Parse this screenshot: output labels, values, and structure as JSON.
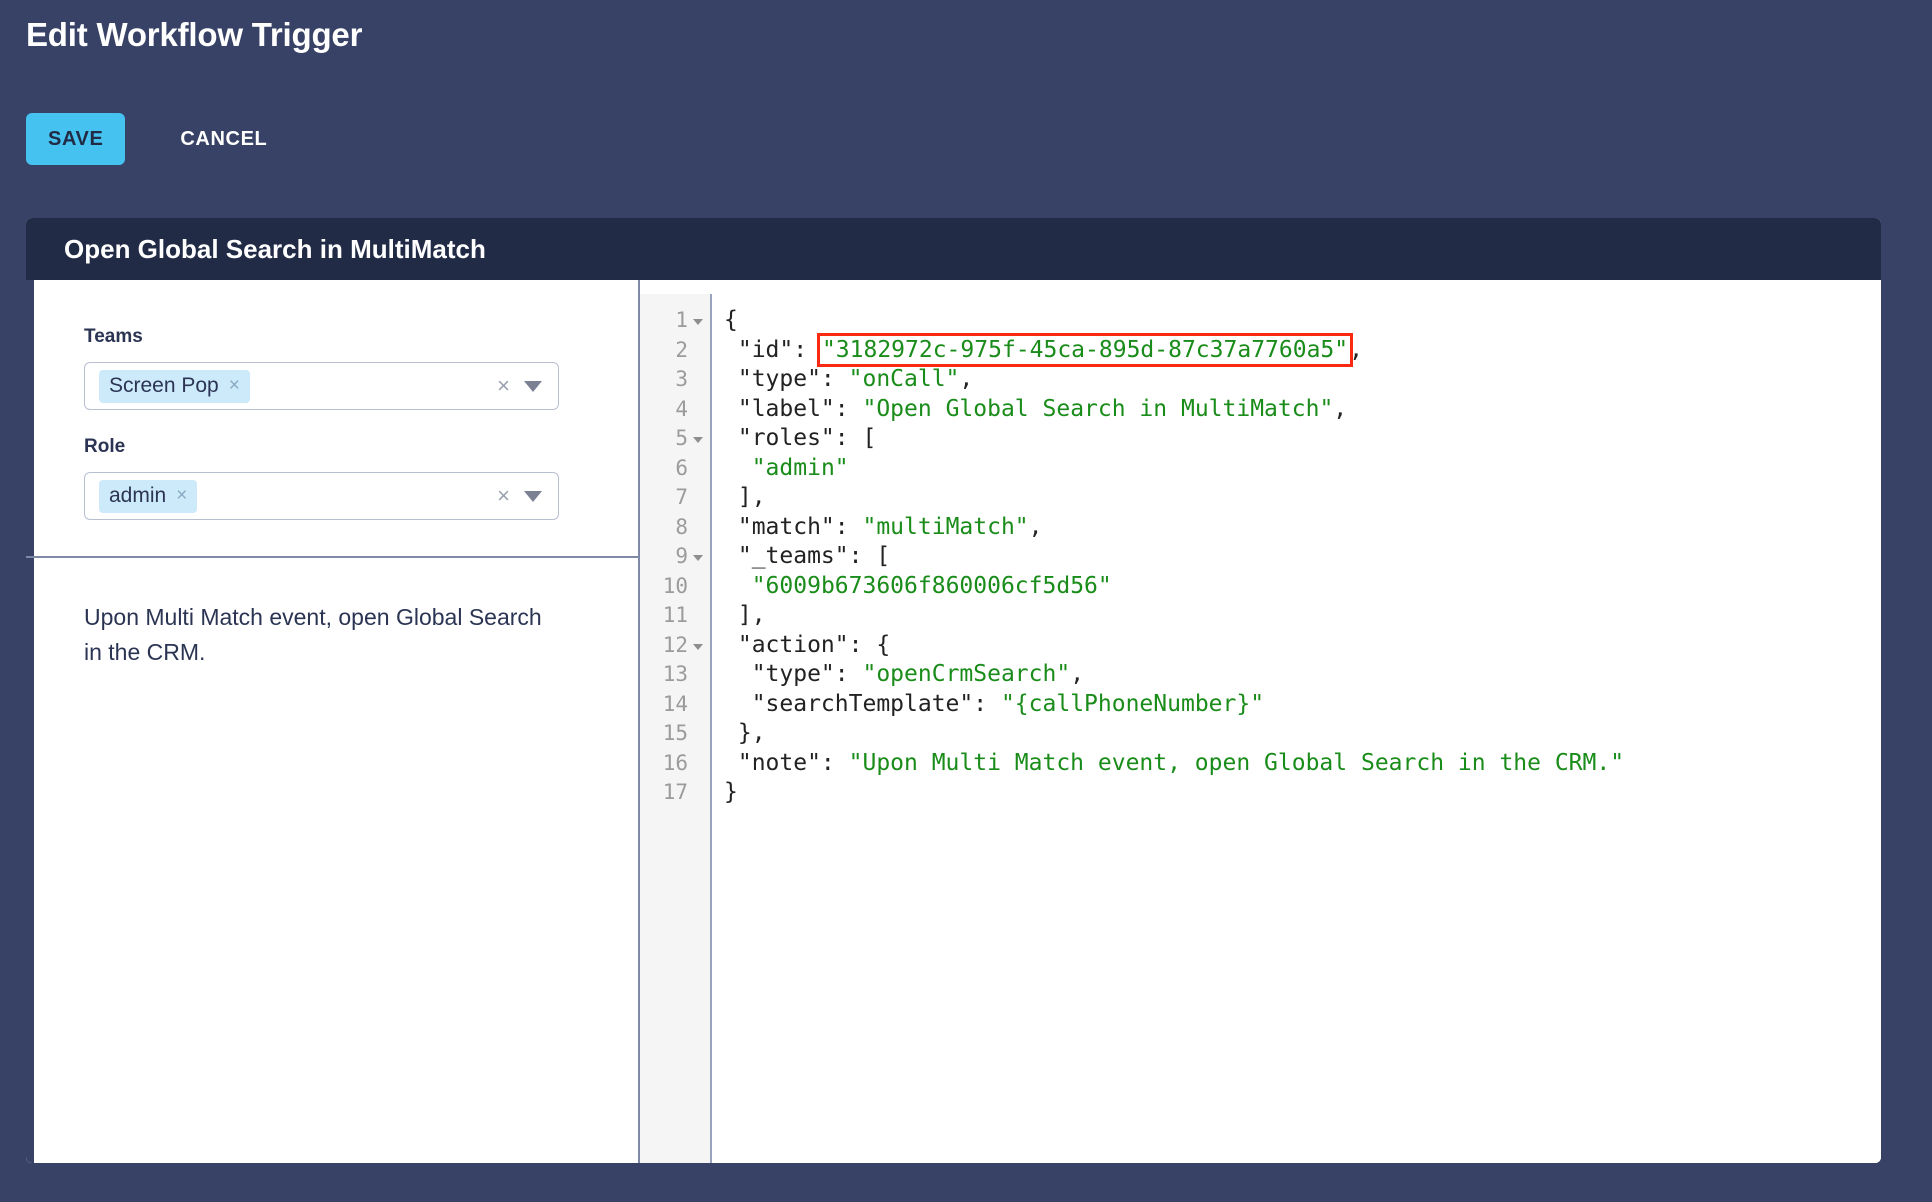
{
  "header": {
    "title": "Edit Workflow Trigger",
    "save_label": "SAVE",
    "cancel_label": "CANCEL",
    "save_color": "#45c2f0"
  },
  "card": {
    "title": "Open Global Search in MultiMatch"
  },
  "form": {
    "teams": {
      "label": "Teams",
      "chip": "Screen Pop",
      "chip_remove": "×",
      "clear": "×"
    },
    "role": {
      "label": "Role",
      "chip": "admin",
      "chip_remove": "×",
      "clear": "×"
    }
  },
  "description": {
    "text": "Upon Multi Match event, open Global Search in the CRM."
  },
  "editor": {
    "highlight_color": "#fa2a10",
    "string_color": "#1a8c1a",
    "lines": [
      {
        "n": 1,
        "fold": true,
        "segments": [
          {
            "t": "{",
            "c": "p"
          }
        ]
      },
      {
        "n": 2,
        "fold": false,
        "segments": [
          {
            "t": " \"id\": ",
            "c": "p"
          },
          {
            "t": "\"3182972c-975f-45ca-895d-87c37a7760a5\"",
            "c": "s",
            "hl": true
          },
          {
            "t": ",",
            "c": "p"
          }
        ]
      },
      {
        "n": 3,
        "fold": false,
        "segments": [
          {
            "t": " \"type\": ",
            "c": "p"
          },
          {
            "t": "\"onCall\"",
            "c": "s"
          },
          {
            "t": ",",
            "c": "p"
          }
        ]
      },
      {
        "n": 4,
        "fold": false,
        "segments": [
          {
            "t": " \"label\": ",
            "c": "p"
          },
          {
            "t": "\"Open Global Search in MultiMatch\"",
            "c": "s"
          },
          {
            "t": ",",
            "c": "p"
          }
        ]
      },
      {
        "n": 5,
        "fold": true,
        "segments": [
          {
            "t": " \"roles\": [",
            "c": "p"
          }
        ]
      },
      {
        "n": 6,
        "fold": false,
        "segments": [
          {
            "t": "  ",
            "c": "p"
          },
          {
            "t": "\"admin\"",
            "c": "s"
          }
        ]
      },
      {
        "n": 7,
        "fold": false,
        "segments": [
          {
            "t": " ],",
            "c": "p"
          }
        ]
      },
      {
        "n": 8,
        "fold": false,
        "segments": [
          {
            "t": " \"match\": ",
            "c": "p"
          },
          {
            "t": "\"multiMatch\"",
            "c": "s"
          },
          {
            "t": ",",
            "c": "p"
          }
        ]
      },
      {
        "n": 9,
        "fold": true,
        "segments": [
          {
            "t": " \"_teams\": [",
            "c": "p"
          }
        ]
      },
      {
        "n": 10,
        "fold": false,
        "segments": [
          {
            "t": "  ",
            "c": "p"
          },
          {
            "t": "\"6009b673606f860006cf5d56\"",
            "c": "s"
          }
        ]
      },
      {
        "n": 11,
        "fold": false,
        "segments": [
          {
            "t": " ],",
            "c": "p"
          }
        ]
      },
      {
        "n": 12,
        "fold": true,
        "segments": [
          {
            "t": " \"action\": {",
            "c": "p"
          }
        ]
      },
      {
        "n": 13,
        "fold": false,
        "segments": [
          {
            "t": "  \"type\": ",
            "c": "p"
          },
          {
            "t": "\"openCrmSearch\"",
            "c": "s"
          },
          {
            "t": ",",
            "c": "p"
          }
        ]
      },
      {
        "n": 14,
        "fold": false,
        "segments": [
          {
            "t": "  \"searchTemplate\": ",
            "c": "p"
          },
          {
            "t": "\"{callPhoneNumber}\"",
            "c": "s"
          }
        ]
      },
      {
        "n": 15,
        "fold": false,
        "segments": [
          {
            "t": " },",
            "c": "p"
          }
        ]
      },
      {
        "n": 16,
        "fold": false,
        "segments": [
          {
            "t": " \"note\": ",
            "c": "p"
          },
          {
            "t": "\"Upon Multi Match event, open Global Search in the CRM.\"",
            "c": "s"
          }
        ]
      },
      {
        "n": 17,
        "fold": false,
        "segments": [
          {
            "t": "}",
            "c": "p"
          }
        ]
      }
    ]
  }
}
